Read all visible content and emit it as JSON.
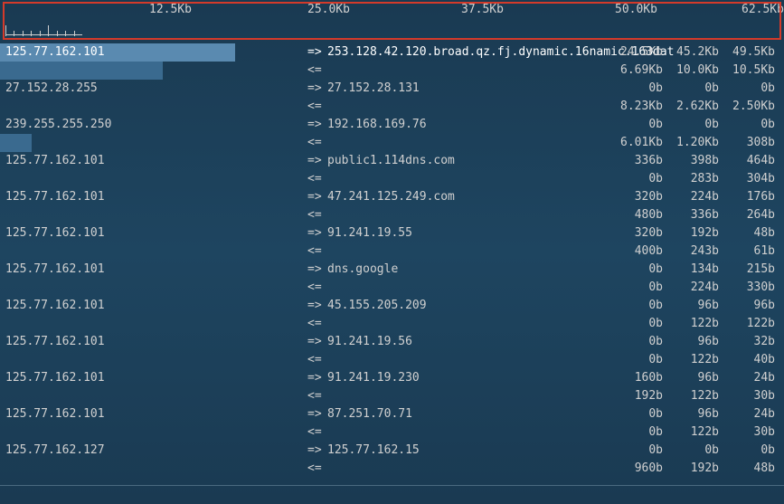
{
  "scale": {
    "labels": [
      "12.5Kb",
      "25.0Kb",
      "37.5Kb",
      "50.0Kb",
      "62.5Kb"
    ],
    "positions": [
      165,
      340,
      510,
      680,
      820
    ]
  },
  "connections": [
    {
      "src": "125.77.162.101",
      "dir": "=>",
      "dst": "253.128.42.120.broad.qz.fj.dynamic.16namic.163dat",
      "c1": "24.5Kb",
      "c2": "45.2Kb",
      "c3": "49.5Kb",
      "bar": 260,
      "highlight": true
    },
    {
      "src": "",
      "dir": "<=",
      "dst": "",
      "c1": "6.69Kb",
      "c2": "10.0Kb",
      "c3": "10.5Kb",
      "bar": 180
    },
    {
      "src": "27.152.28.255",
      "dir": "=>",
      "dst": "27.152.28.131",
      "c1": "0b",
      "c2": "0b",
      "c3": "0b",
      "bar": 0
    },
    {
      "src": "",
      "dir": "<=",
      "dst": "",
      "c1": "8.23Kb",
      "c2": "2.62Kb",
      "c3": "2.50Kb",
      "bar": 0
    },
    {
      "src": "239.255.255.250",
      "dir": "=>",
      "dst": "192.168.169.76",
      "c1": "0b",
      "c2": "0b",
      "c3": "0b",
      "bar": 0
    },
    {
      "src": "",
      "dir": "<=",
      "dst": "",
      "c1": "6.01Kb",
      "c2": "1.20Kb",
      "c3": "308b",
      "bar": 35
    },
    {
      "src": "125.77.162.101",
      "dir": "=>",
      "dst": "public1.114dns.com",
      "c1": "336b",
      "c2": "398b",
      "c3": "464b",
      "bar": 0
    },
    {
      "src": "",
      "dir": "<=",
      "dst": "",
      "c1": "0b",
      "c2": "283b",
      "c3": "304b",
      "bar": 0
    },
    {
      "src": "125.77.162.101",
      "dir": "=>",
      "dst": "47.241.125.249.com",
      "c1": "320b",
      "c2": "224b",
      "c3": "176b",
      "bar": 0
    },
    {
      "src": "",
      "dir": "<=",
      "dst": "",
      "c1": "480b",
      "c2": "336b",
      "c3": "264b",
      "bar": 0
    },
    {
      "src": "125.77.162.101",
      "dir": "=>",
      "dst": "91.241.19.55",
      "c1": "320b",
      "c2": "192b",
      "c3": "48b",
      "bar": 0
    },
    {
      "src": "",
      "dir": "<=",
      "dst": "",
      "c1": "400b",
      "c2": "243b",
      "c3": "61b",
      "bar": 0
    },
    {
      "src": "125.77.162.101",
      "dir": "=>",
      "dst": "dns.google",
      "c1": "0b",
      "c2": "134b",
      "c3": "215b",
      "bar": 0
    },
    {
      "src": "",
      "dir": "<=",
      "dst": "",
      "c1": "0b",
      "c2": "224b",
      "c3": "330b",
      "bar": 0
    },
    {
      "src": "125.77.162.101",
      "dir": "=>",
      "dst": "45.155.205.209",
      "c1": "0b",
      "c2": "96b",
      "c3": "96b",
      "bar": 0
    },
    {
      "src": "",
      "dir": "<=",
      "dst": "",
      "c1": "0b",
      "c2": "122b",
      "c3": "122b",
      "bar": 0
    },
    {
      "src": "125.77.162.101",
      "dir": "=>",
      "dst": "91.241.19.56",
      "c1": "0b",
      "c2": "96b",
      "c3": "32b",
      "bar": 0
    },
    {
      "src": "",
      "dir": "<=",
      "dst": "",
      "c1": "0b",
      "c2": "122b",
      "c3": "40b",
      "bar": 0
    },
    {
      "src": "125.77.162.101",
      "dir": "=>",
      "dst": "91.241.19.230",
      "c1": "160b",
      "c2": "96b",
      "c3": "24b",
      "bar": 0
    },
    {
      "src": "",
      "dir": "<=",
      "dst": "",
      "c1": "192b",
      "c2": "122b",
      "c3": "30b",
      "bar": 0
    },
    {
      "src": "125.77.162.101",
      "dir": "=>",
      "dst": "87.251.70.71",
      "c1": "0b",
      "c2": "96b",
      "c3": "24b",
      "bar": 0
    },
    {
      "src": "",
      "dir": "<=",
      "dst": "",
      "c1": "0b",
      "c2": "122b",
      "c3": "30b",
      "bar": 0
    },
    {
      "src": "125.77.162.127",
      "dir": "=>",
      "dst": "125.77.162.15",
      "c1": "0b",
      "c2": "0b",
      "c3": "0b",
      "bar": 0
    },
    {
      "src": "",
      "dir": "<=",
      "dst": "",
      "c1": "960b",
      "c2": "192b",
      "c3": "48b",
      "bar": 0
    }
  ]
}
